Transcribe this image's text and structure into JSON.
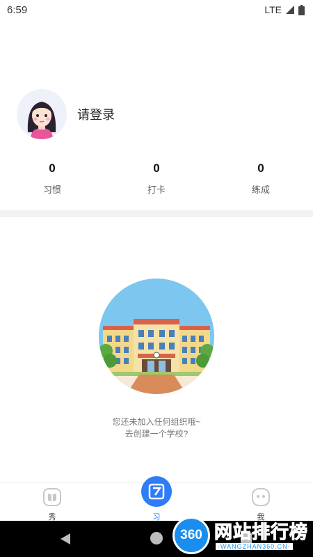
{
  "status_bar": {
    "time": "6:59",
    "network": "LTE"
  },
  "profile": {
    "login_text": "请登录"
  },
  "stats": [
    {
      "value": "0",
      "label": "习惯"
    },
    {
      "value": "0",
      "label": "打卡"
    },
    {
      "value": "0",
      "label": "练成"
    }
  ],
  "empty_state": {
    "line1": "您还未加入任何组织哦~",
    "line2": "去创建一个学校?"
  },
  "tabs": [
    {
      "label": "秀",
      "icon": "book-icon"
    },
    {
      "label": "习",
      "icon": "xi-logo-icon"
    },
    {
      "label": "我",
      "icon": "face-icon"
    }
  ],
  "watermark": {
    "badge": "360",
    "title": "网站排行榜",
    "subtitle": "-WANGZHAN360.CN-"
  },
  "colors": {
    "accent": "#2e7cf6",
    "divider": "#f2f2f4",
    "sky": "#7cc6ef"
  }
}
